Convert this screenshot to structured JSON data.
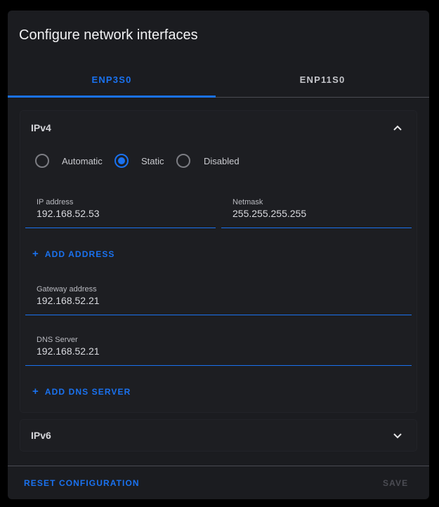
{
  "dialog": {
    "title": "Configure network interfaces"
  },
  "tabs": [
    {
      "label": "ENP3S0",
      "active": true
    },
    {
      "label": "ENP11S0",
      "active": false
    }
  ],
  "ipv4": {
    "title": "IPv4",
    "expanded": true,
    "modes": [
      "Automatic",
      "Static",
      "Disabled"
    ],
    "selected_mode": "Static",
    "ip_address": {
      "label": "IP address",
      "value": "192.168.52.53"
    },
    "netmask": {
      "label": "Netmask",
      "value": "255.255.255.255"
    },
    "add_address": "ADD ADDRESS",
    "gateway": {
      "label": "Gateway address",
      "value": "192.168.52.21"
    },
    "dns": {
      "label": "DNS Server",
      "value": "192.168.52.21"
    },
    "add_dns": "ADD DNS SERVER"
  },
  "ipv6": {
    "title": "IPv6",
    "expanded": false
  },
  "footer": {
    "reset": "RESET CONFIGURATION",
    "save": "SAVE"
  },
  "colors": {
    "accent": "#1a72f0",
    "background": "#1b1c20"
  }
}
